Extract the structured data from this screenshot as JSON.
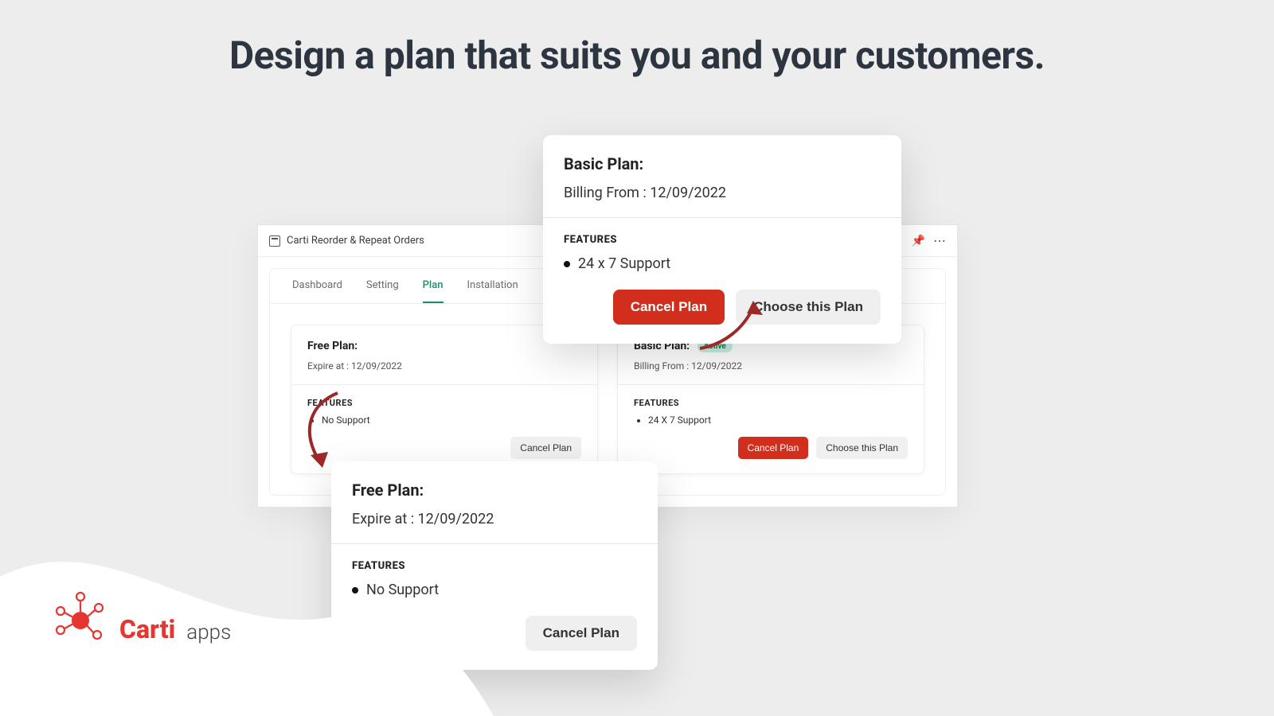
{
  "headline": "Design a plan that suits you and your customers.",
  "app": {
    "title": "Carti Reorder & Repeat Orders",
    "tabs": {
      "dashboard": "Dashboard",
      "setting": "Setting",
      "plan": "Plan",
      "installation": "Installation"
    },
    "free": {
      "title": "Free Plan:",
      "sub": "Expire at : 12/09/2022",
      "features_h": "FEATURES",
      "feat1": "No Support",
      "cancel": "Cancel Plan"
    },
    "basic": {
      "title": "Basic Plan:",
      "badge": "Active",
      "sub": "Billing From : 12/09/2022",
      "features_h": "FEATURES",
      "feat1": "24 X 7 Support",
      "cancel": "Cancel Plan",
      "choose": "Choose this Plan"
    }
  },
  "callout_basic": {
    "title": "Basic Plan:",
    "sub": "Billing From : 12/09/2022",
    "feat_h": "FEATURES",
    "feat1": "24 x 7 Support",
    "cancel": "Cancel Plan",
    "choose": "Choose this Plan"
  },
  "callout_free": {
    "title": "Free Plan:",
    "sub": "Expire at : 12/09/2022",
    "feat_h": "FEATURES",
    "feat1": "No Support",
    "cancel": "Cancel Plan"
  },
  "brand": {
    "name": "Carti",
    "suffix": "apps"
  }
}
